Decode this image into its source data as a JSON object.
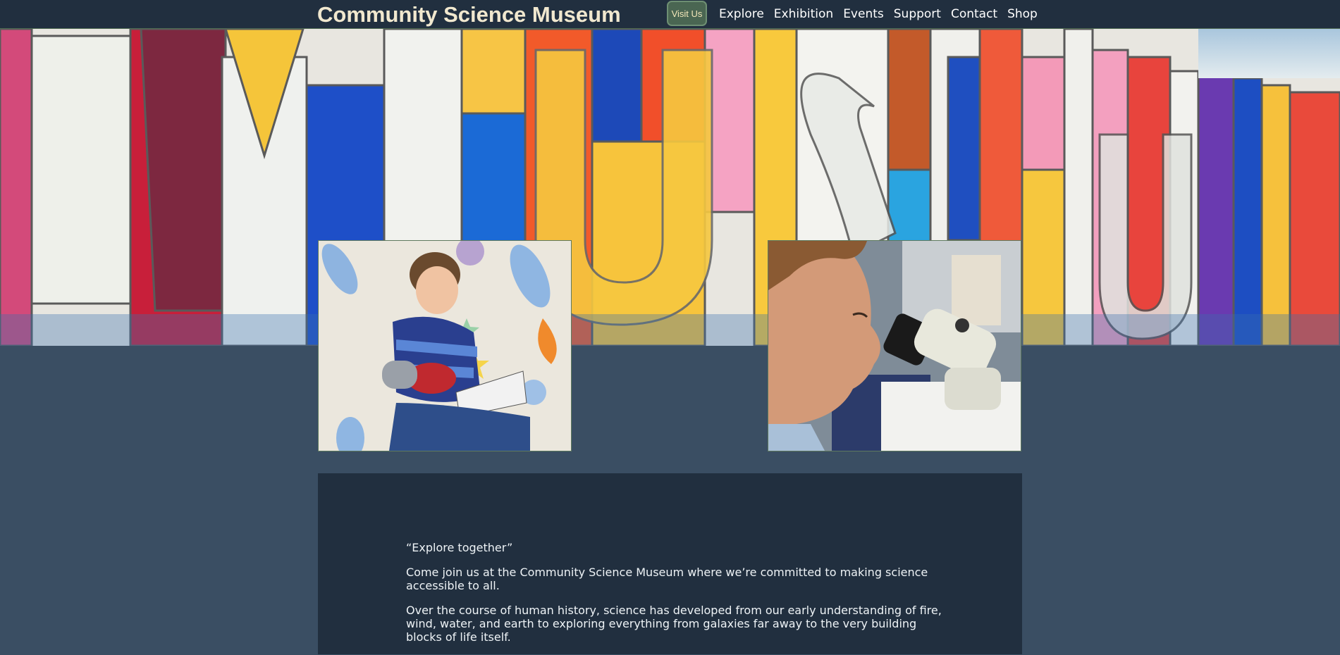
{
  "header": {
    "site_title": "Community Science Museum",
    "visit_label": "Visit Us",
    "nav": [
      "Explore",
      "Exhibition",
      "Events",
      "Support",
      "Contact",
      "Shop"
    ]
  },
  "intro": {
    "tagline": "“Explore together”",
    "paragraph1": "Come join us at the Community Science Museum where we’re committed to making science accessible to all.",
    "paragraph2": "Over the course of human history, science has developed from our early understanding of fire, wind, water, and earth to exploring everything from galaxies far away to the very building blocks of life itself."
  },
  "colors": {
    "header_bg": "#212f3f",
    "page_bg": "#3a4e63",
    "title": "#f1e8cf",
    "visit_button": "#4a6652"
  }
}
